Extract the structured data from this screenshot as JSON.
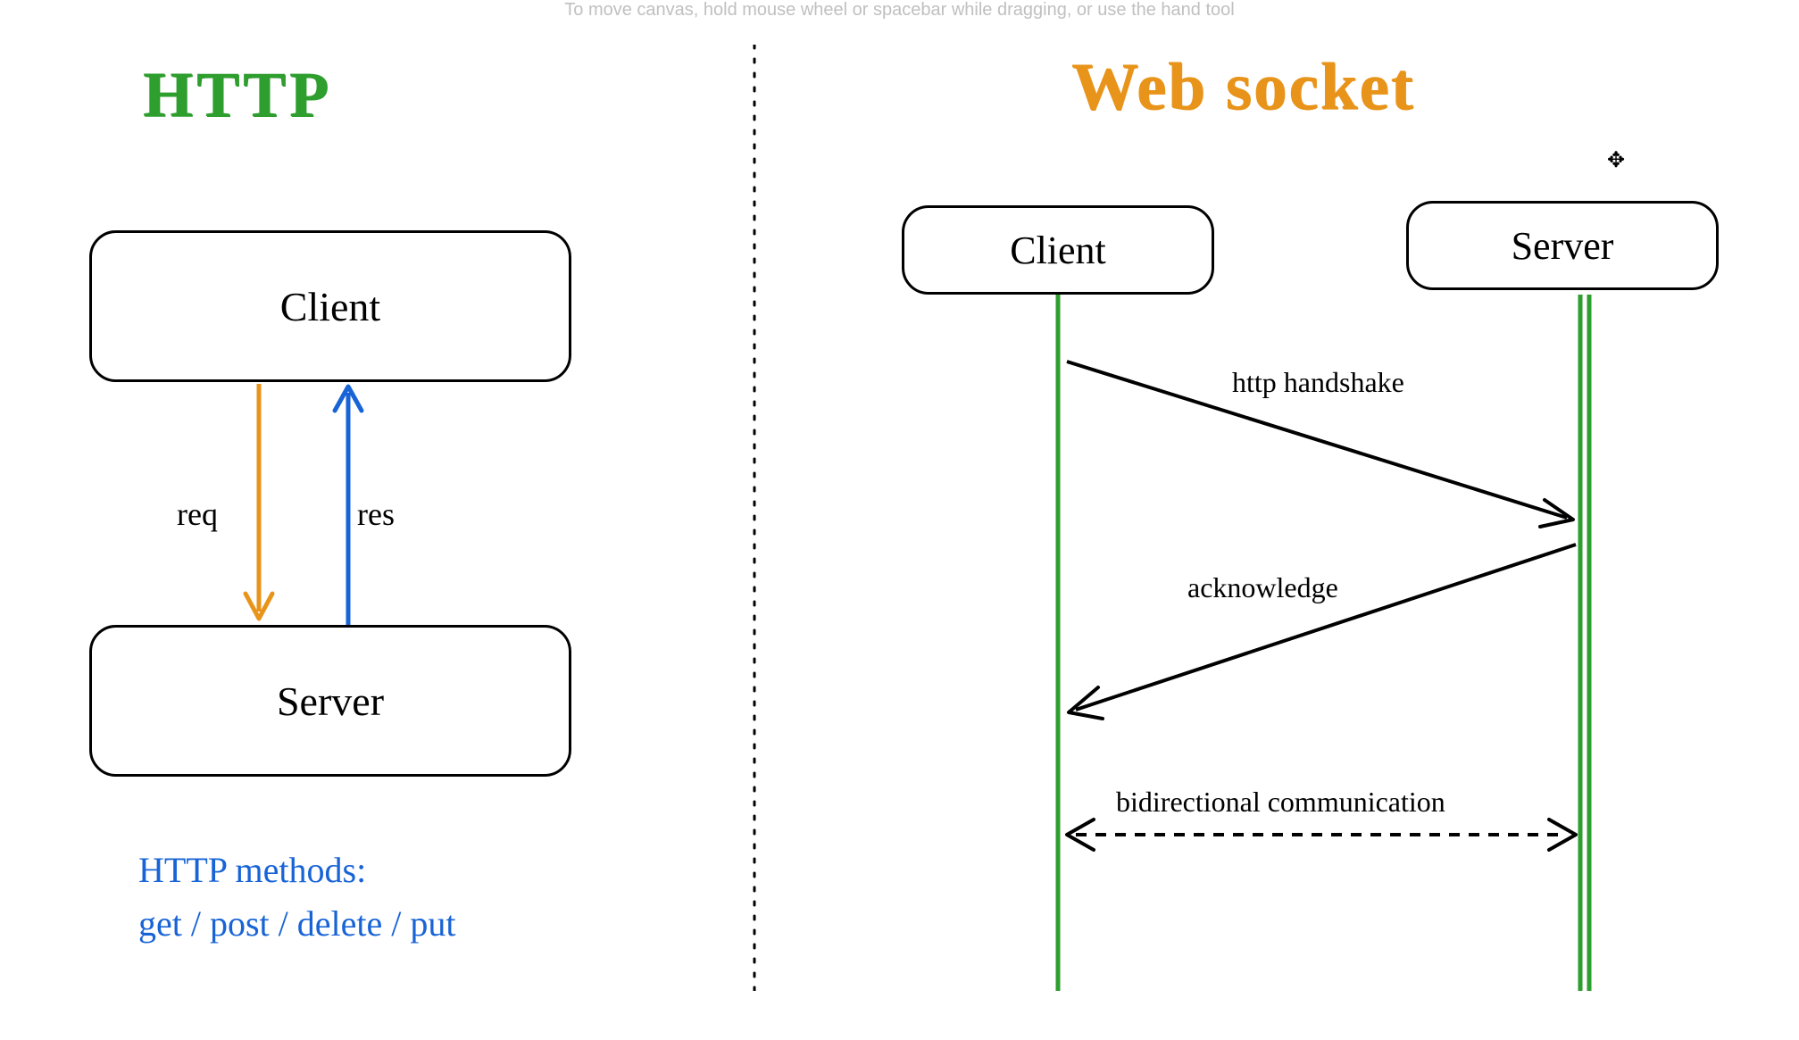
{
  "hint": "To move canvas, hold mouse wheel or spacebar while dragging, or use the hand tool",
  "http": {
    "title": "HTTP",
    "client_label": "Client",
    "server_label": "Server",
    "req_label": "req",
    "res_label": "res",
    "methods_heading": "HTTP methods:",
    "methods_list": "get / post / delete / put"
  },
  "websocket": {
    "title": "Web socket",
    "client_label": "Client",
    "server_label": "Server",
    "handshake_label": "http handshake",
    "ack_label": "acknowledge",
    "bidir_label": "bidirectional communication"
  },
  "colors": {
    "http_green": "#2e9e2e",
    "ws_orange": "#e8941a",
    "req_orange": "#e8941a",
    "res_blue": "#1864d6",
    "methods_blue": "#1864d6",
    "lifeline_green": "#2e9e2e"
  }
}
